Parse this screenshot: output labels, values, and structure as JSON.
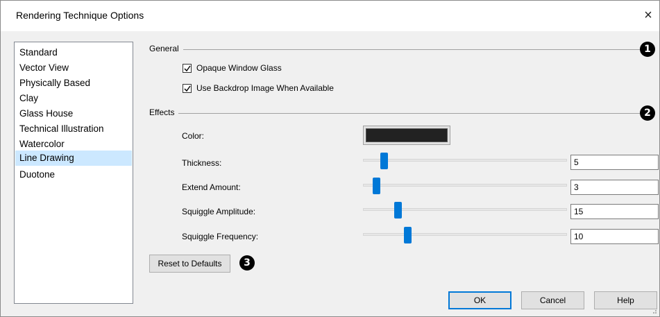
{
  "window": {
    "title": "Rendering Technique Options",
    "close_glyph": "×"
  },
  "techniques": {
    "items": [
      "Standard",
      "Vector View",
      "Physically Based",
      "Clay",
      "Glass House",
      "Technical Illustration",
      "Watercolor",
      "Line Drawing",
      "Duotone"
    ],
    "selected": "Line Drawing"
  },
  "general": {
    "label": "General",
    "callout": "1",
    "opaque_glass": {
      "label": "Opaque Window Glass",
      "checked": true
    },
    "backdrop": {
      "label": "Use Backdrop Image When Available",
      "checked": true
    }
  },
  "effects": {
    "label": "Effects",
    "callout": "2",
    "color": {
      "label": "Color:",
      "value": "#222222"
    },
    "thickness": {
      "label": "Thickness:",
      "value": "5",
      "slider_fraction": 0.09
    },
    "extend_amount": {
      "label": "Extend Amount:",
      "value": "3",
      "slider_fraction": 0.05
    },
    "squiggle_amplitude": {
      "label": "Squiggle Amplitude:",
      "value": "15",
      "slider_fraction": 0.16
    },
    "squiggle_frequency": {
      "label": "Squiggle Frequency:",
      "value": "10",
      "slider_fraction": 0.21
    }
  },
  "reset": {
    "label": "Reset to Defaults",
    "callout": "3"
  },
  "buttons": {
    "ok": "OK",
    "cancel": "Cancel",
    "help": "Help"
  },
  "colors": {
    "accent": "#0078d7",
    "selection": "#cce8ff"
  }
}
